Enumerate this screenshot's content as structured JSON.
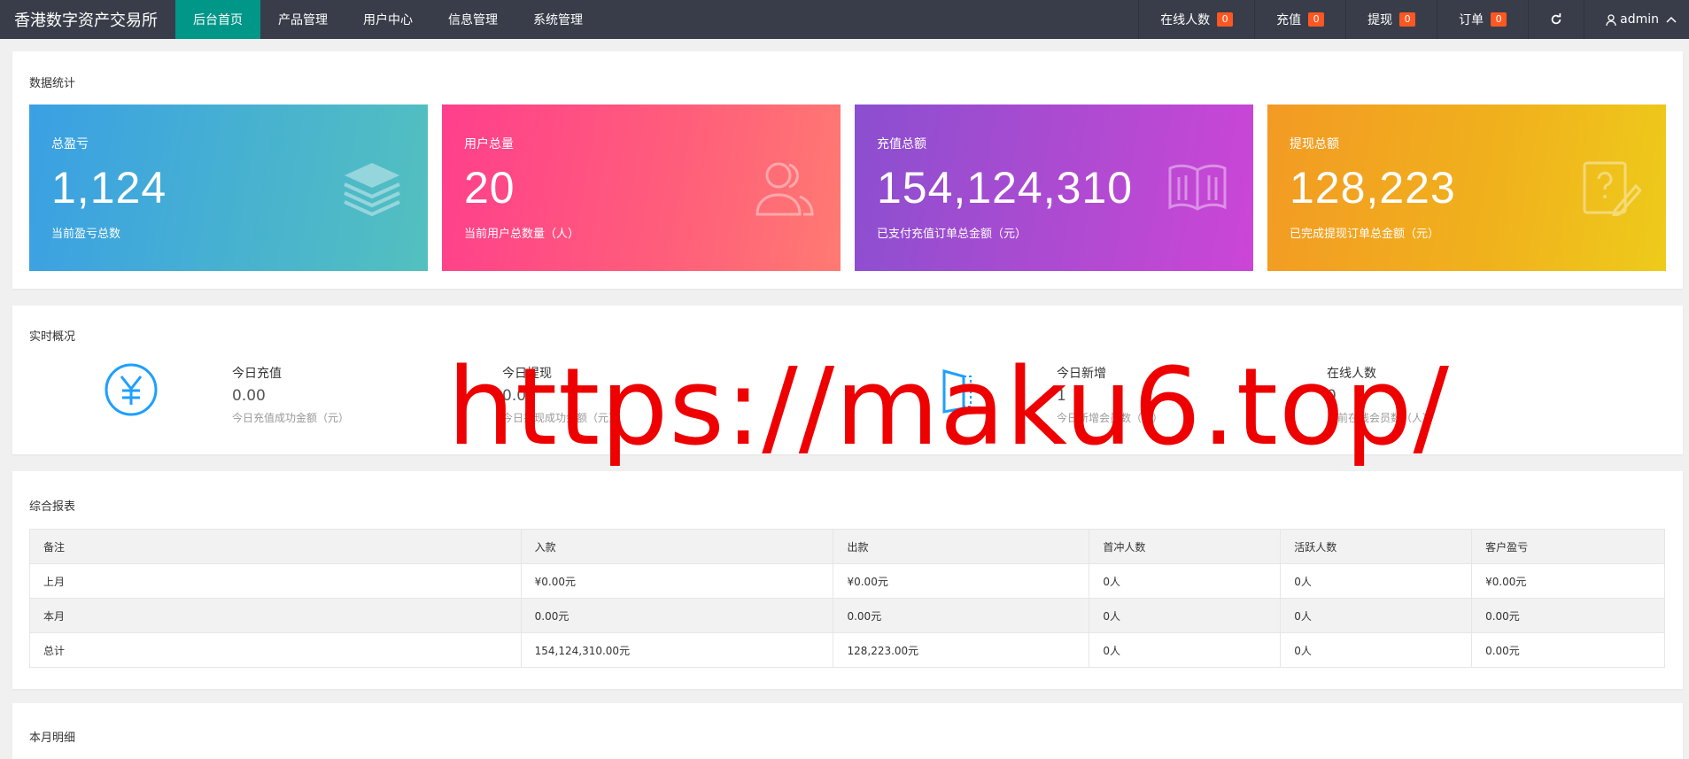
{
  "brand": "香港数字资产交易所",
  "nav": [
    "后台首页",
    "产品管理",
    "用户中心",
    "信息管理",
    "系统管理"
  ],
  "right_nav": {
    "online": {
      "label": "在线人数",
      "count": "0"
    },
    "recharge": {
      "label": "充值",
      "count": "0"
    },
    "withdraw": {
      "label": "提现",
      "count": "0"
    },
    "orders": {
      "label": "订单",
      "count": "0"
    },
    "user": "admin"
  },
  "stats": {
    "title": "数据统计",
    "items": [
      {
        "label": "总盈亏",
        "value": "1,124",
        "sub": "当前盈亏总数",
        "icon": "layers-icon"
      },
      {
        "label": "用户总量",
        "value": "20",
        "sub": "当前用户总数量（人）",
        "icon": "users-icon"
      },
      {
        "label": "充值总额",
        "value": "154,124,310",
        "sub": "已支付充值订单总金额（元）",
        "icon": "book-icon"
      },
      {
        "label": "提现总额",
        "value": "128,223",
        "sub": "已完成提现订单总金额（元）",
        "icon": "help-edit-icon"
      }
    ]
  },
  "realtime": {
    "title": "实时概况",
    "items": [
      {
        "label": "今日充值",
        "value": "0.00",
        "sub": "今日充值成功金额（元）"
      },
      {
        "label": "今日提现",
        "value": "0.00",
        "sub": "今日提现成功金额（元）"
      },
      {
        "label": "今日新增",
        "value": "1",
        "sub": "今日新增会员数（人）"
      },
      {
        "label": "在线人数",
        "value": "0",
        "sub": "当前在线会员数（人）"
      }
    ]
  },
  "report": {
    "title": "综合报表",
    "headers": [
      "备注",
      "入款",
      "出款",
      "首冲人数",
      "活跃人数",
      "客户盈亏"
    ],
    "rows": [
      [
        "上月",
        "¥0.00元",
        "¥0.00元",
        "0人",
        "0人",
        "¥0.00元"
      ],
      [
        "本月",
        "0.00元",
        "0.00元",
        "0人",
        "0人",
        "0.00元"
      ],
      [
        "总计",
        "154,124,310.00元",
        "128,223.00元",
        "0人",
        "0人",
        "0.00元"
      ]
    ]
  },
  "monthly": {
    "title": "本月明细"
  },
  "watermark": "https://maku6.top/"
}
